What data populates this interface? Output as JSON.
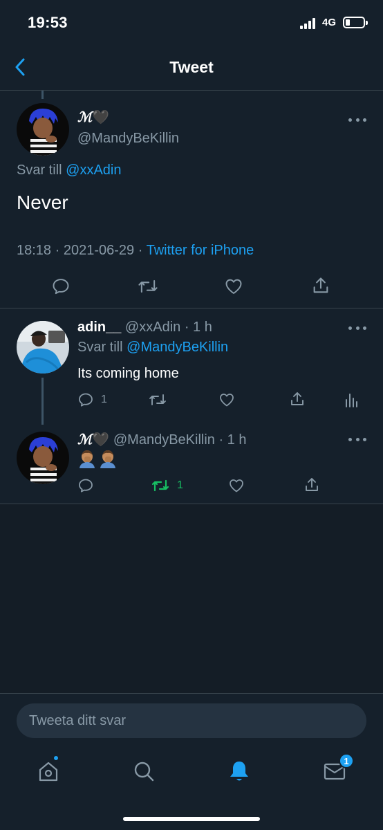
{
  "status_bar": {
    "time": "19:53",
    "network": "4G"
  },
  "header": {
    "title": "Tweet"
  },
  "main_tweet": {
    "name": "ℳ",
    "name_emoji": "🖤",
    "handle": "@MandyBeKillin",
    "reply_prefix": "Svar till",
    "reply_to": "@xxAdin",
    "text": "Never",
    "time": "18:18",
    "date": "2021-06-29",
    "separator": "·",
    "source": "Twitter for iPhone"
  },
  "replies": [
    {
      "name": "adin__",
      "handle": "@xxAdin",
      "age": "· 1 h",
      "reply_prefix": "Svar till",
      "reply_to": "@MandyBeKillin",
      "text": "Its coming home",
      "reply_count": "1",
      "retweet_count": "",
      "retweeted": false
    },
    {
      "name": "ℳ",
      "name_emoji": "🖤",
      "handle": "@MandyBeKillin",
      "age": "· 1 h",
      "emojis": [
        "🤦🏽‍♂️",
        "🤦🏽‍♂️"
      ],
      "reply_count": "",
      "retweet_count": "1",
      "retweeted": true
    }
  ],
  "composer": {
    "placeholder": "Tweeta ditt svar"
  },
  "tab_bar": {
    "messages_badge": "1"
  },
  "colors": {
    "background": "#15202b",
    "accent": "#1da1f2",
    "retweet_green": "#17bf63",
    "muted": "#8899a6"
  },
  "icons": [
    "back-arrow-icon",
    "more-icon",
    "reply-icon",
    "retweet-icon",
    "like-icon",
    "share-icon",
    "analytics-icon",
    "home-icon",
    "search-icon",
    "notifications-icon",
    "messages-icon"
  ]
}
